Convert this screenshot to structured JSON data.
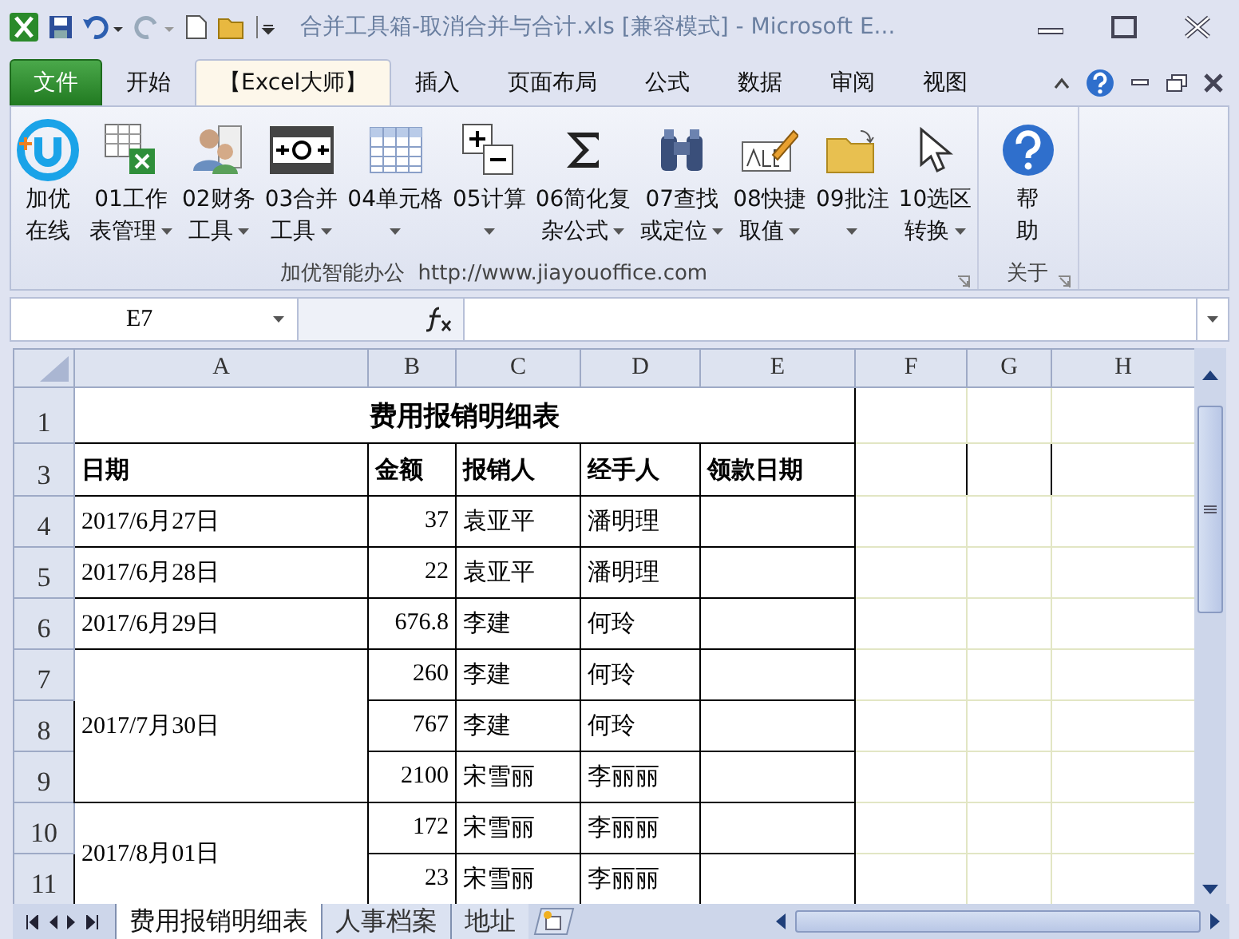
{
  "window": {
    "title": "合并工具箱-取消合并与合计.xls  [兼容模式]  -  Microsoft E..."
  },
  "ribbon_tabs": [
    {
      "label": "文件",
      "kind": "file",
      "selected": false
    },
    {
      "label": "开始",
      "kind": "tab",
      "selected": false
    },
    {
      "label": "【Excel大师】",
      "kind": "tab",
      "selected": true
    },
    {
      "label": "插入",
      "kind": "tab",
      "selected": false
    },
    {
      "label": "页面布局",
      "kind": "tab",
      "selected": false
    },
    {
      "label": "公式",
      "kind": "tab",
      "selected": false
    },
    {
      "label": "数据",
      "kind": "tab",
      "selected": false
    },
    {
      "label": "审阅",
      "kind": "tab",
      "selected": false
    },
    {
      "label": "视图",
      "kind": "tab",
      "selected": false
    }
  ],
  "ribbon_groups": [
    {
      "label": "加优智能办公  http://www.jiayouoffice.com",
      "tools": [
        {
          "lines": [
            "加优",
            "在线"
          ],
          "dropdown": false
        },
        {
          "lines": [
            "01工作",
            "表管理"
          ],
          "dropdown": true
        },
        {
          "lines": [
            "02财务",
            "工具"
          ],
          "dropdown": true
        },
        {
          "lines": [
            "03合并",
            "工具"
          ],
          "dropdown": true
        },
        {
          "lines": [
            "04单元格"
          ],
          "dropdown": true
        },
        {
          "lines": [
            "05计算"
          ],
          "dropdown": true
        },
        {
          "lines": [
            "06简化复",
            "杂公式"
          ],
          "dropdown": true
        },
        {
          "lines": [
            "07查找",
            "或定位"
          ],
          "dropdown": true
        },
        {
          "lines": [
            "08快捷",
            "取值"
          ],
          "dropdown": true
        },
        {
          "lines": [
            "09批注"
          ],
          "dropdown": true
        },
        {
          "lines": [
            "10选区",
            "转换"
          ],
          "dropdown": true
        }
      ]
    },
    {
      "label": "关于",
      "tools": [
        {
          "lines": [
            "帮",
            "助"
          ],
          "dropdown": false
        }
      ]
    }
  ],
  "formula_bar": {
    "name_box": "E7"
  },
  "sheet": {
    "columns": [
      "A",
      "B",
      "C",
      "D",
      "E",
      "F",
      "G",
      "H"
    ],
    "title_row": "1",
    "title": "费用报销明细表",
    "header_row": "3",
    "headers": [
      "日期",
      "金额",
      "报销人",
      "经手人",
      "领款日期"
    ],
    "groups": [
      {
        "date": "2017/6月27日",
        "entries": [
          {
            "row": "4",
            "amount": "37",
            "reporter": "袁亚平",
            "handler": "潘明理"
          }
        ]
      },
      {
        "date": "2017/6月28日",
        "entries": [
          {
            "row": "5",
            "amount": "22",
            "reporter": "袁亚平",
            "handler": "潘明理"
          }
        ]
      },
      {
        "date": "2017/6月29日",
        "entries": [
          {
            "row": "6",
            "amount": "676.8",
            "reporter": "李建",
            "handler": "何玲"
          }
        ]
      },
      {
        "date": "2017/7月30日",
        "entries": [
          {
            "row": "7",
            "amount": "260",
            "reporter": "李建",
            "handler": "何玲"
          },
          {
            "row": "8",
            "amount": "767",
            "reporter": "李建",
            "handler": "何玲"
          },
          {
            "row": "9",
            "amount": "2100",
            "reporter": "宋雪丽",
            "handler": "李丽丽"
          }
        ]
      },
      {
        "date": "2017/8月01日",
        "entries": [
          {
            "row": "10",
            "amount": "172",
            "reporter": "宋雪丽",
            "handler": "李丽丽"
          },
          {
            "row": "11",
            "amount": "23",
            "reporter": "宋雪丽",
            "handler": "李丽丽"
          }
        ]
      }
    ]
  },
  "sheet_tabs": [
    {
      "label": "费用报销明细表",
      "selected": true
    },
    {
      "label": "人事档案",
      "selected": false
    },
    {
      "label": "地址",
      "selected": false
    }
  ]
}
